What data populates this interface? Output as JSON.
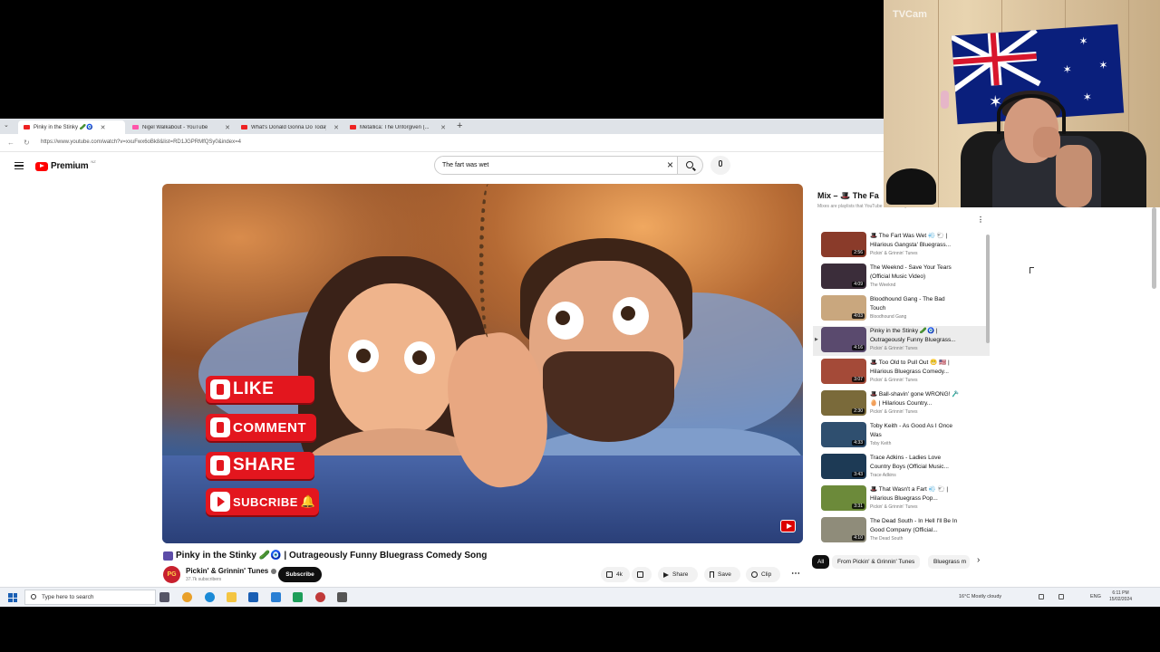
{
  "browser": {
    "tabs": [
      {
        "label": "Pinky in the Stinky 🥒🧿",
        "active": true
      },
      {
        "label": "Nigel Walkabout - YouTube",
        "active": false
      },
      {
        "label": "What's Donald Gonna Do Today?",
        "active": false
      },
      {
        "label": "Metallica: The Unforgiven (...",
        "active": false
      }
    ],
    "url": "https://www.youtube.com/watch?v=xxuFwx6oBk8&list=RD1JGPRMfQSy0&index=4"
  },
  "youtube": {
    "logo_text": "Premium",
    "logo_sup": "NZ",
    "search_value": "The fart was wet"
  },
  "video": {
    "overlay_buttons": [
      "LIKE",
      "COMMENT",
      "SHARE",
      "SUBCRIBE"
    ],
    "title": "Pinky in the Stinky 🥒🧿 | Outrageously Funny Bluegrass Comedy Song",
    "channel": "Pickin' & Grinnin' Tunes",
    "avatar_initials": "PG",
    "subscribers": "37.7k subscribers",
    "subscribe_label": "Subscribe",
    "actions": {
      "likes": "4k",
      "share": "Share",
      "save": "Save",
      "clip": "Clip"
    }
  },
  "playlist": {
    "title": "Mix – 🎩 The Fa",
    "subtitle": "Mixes are playlists that YouTube makes for you",
    "items": [
      {
        "title": "🎩 The Fart Was Wet 💨 🐑 | Hilarious Gangsta' Bluegrass...",
        "channel": "Pickin' & Grinnin' Tunes",
        "duration": "2:56",
        "thumb": "#8a3b2a",
        "current": false
      },
      {
        "title": "The Weeknd - Save Your Tears (Official Music Video)",
        "channel": "The Weeknd",
        "duration": "4:09",
        "thumb": "#3b2d3a",
        "current": false
      },
      {
        "title": "Bloodhound Gang - The Bad Touch",
        "channel": "Bloodhound Gang",
        "duration": "4:03",
        "thumb": "#c9a77e",
        "current": false
      },
      {
        "title": "Pinky in the Stinky 🥒🧿 | Outrageously Funny Bluegrass...",
        "channel": "Pickin' & Grinnin' Tunes",
        "duration": "4:16",
        "thumb": "#5a4a6e",
        "current": true
      },
      {
        "title": "🎩 Too Old to Pull Out 😬 🇺🇸 | Hilarious Bluegrass Comedy...",
        "channel": "Pickin' & Grinnin' Tunes",
        "duration": "3:07",
        "thumb": "#a44a38",
        "current": false
      },
      {
        "title": "🎩 Ball-shavin' gone WRONG! 🪒🥚 | Hilarious Country...",
        "channel": "Pickin' & Grinnin' Tunes",
        "duration": "2:30",
        "thumb": "#7a6a3a",
        "current": false
      },
      {
        "title": "Toby Keith - As Good As I Once Was",
        "channel": "Toby Keith",
        "duration": "4:33",
        "thumb": "#2f4f6f",
        "current": false
      },
      {
        "title": "Trace Adkins - Ladies Love Country Boys (Official Music...",
        "channel": "Trace Adkins",
        "duration": "3:43",
        "thumb": "#1d3a55",
        "current": false
      },
      {
        "title": "🎩 That Wasn't a Fart 💨 🐑 | Hilarious Bluegrass Pop...",
        "channel": "Pickin' & Grinnin' Tunes",
        "duration": "3:31",
        "thumb": "#6c8a3a",
        "current": false
      },
      {
        "title": "The Dead South - In Hell I'll Be In Good Company (Official...",
        "channel": "The Dead South",
        "duration": "4:10",
        "thumb": "#8f8c7a",
        "current": false
      }
    ],
    "chips": [
      "All",
      "From Pickin' & Grinnin' Tunes",
      "Bluegrass m"
    ]
  },
  "taskbar": {
    "search_placeholder": "Type here to search",
    "weather": "16°C  Mostly cloudy",
    "lang": "ENG",
    "time": "6:11 PM",
    "date": "15/02/2024"
  },
  "webcam": {
    "label": "TVCam"
  },
  "colors": {
    "youtube_red": "#ff0000",
    "flag_blue": "#0a1f7c"
  }
}
